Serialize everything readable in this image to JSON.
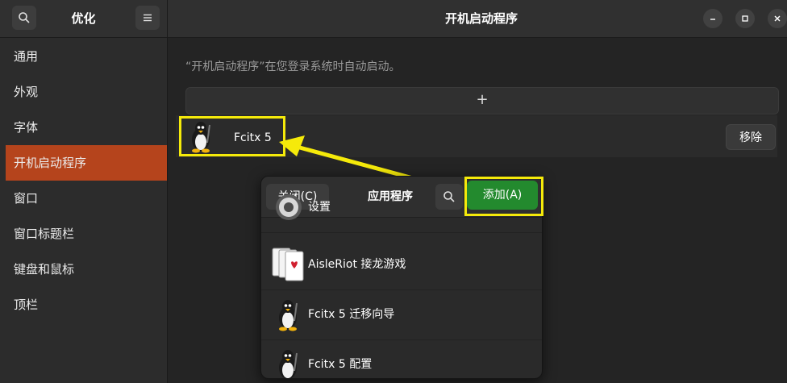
{
  "sidebar": {
    "title": "优化",
    "items": [
      {
        "label": "通用"
      },
      {
        "label": "外观"
      },
      {
        "label": "字体"
      },
      {
        "label": "开机启动程序"
      },
      {
        "label": "窗口"
      },
      {
        "label": "窗口标题栏"
      },
      {
        "label": "键盘和鼠标"
      },
      {
        "label": "顶栏"
      }
    ],
    "active_index": 3
  },
  "header": {
    "title": "开机启动程序"
  },
  "main": {
    "description": "“开机启动程序”在您登录系统时自动启动。",
    "add_row_symbol": "+",
    "startup_app": {
      "name": "Fcitx 5",
      "remove_label": "移除",
      "icon": "tux-icon"
    }
  },
  "dialog": {
    "close_label": "关闭(C)",
    "title": "应用程序",
    "add_label": "添加(A)",
    "items": [
      {
        "name": "设置",
        "icon": "settings-gear-icon"
      },
      {
        "name": "AisleRiot 接龙游戏",
        "icon": "playing-cards-icon"
      },
      {
        "name": "Fcitx 5 迁移向导",
        "icon": "tux-icon"
      },
      {
        "name": "Fcitx 5 配置",
        "icon": "tux-icon"
      }
    ]
  },
  "colors": {
    "accent": "#b5441c",
    "highlight": "#f5ea0a",
    "add_button": "#238a2e"
  }
}
